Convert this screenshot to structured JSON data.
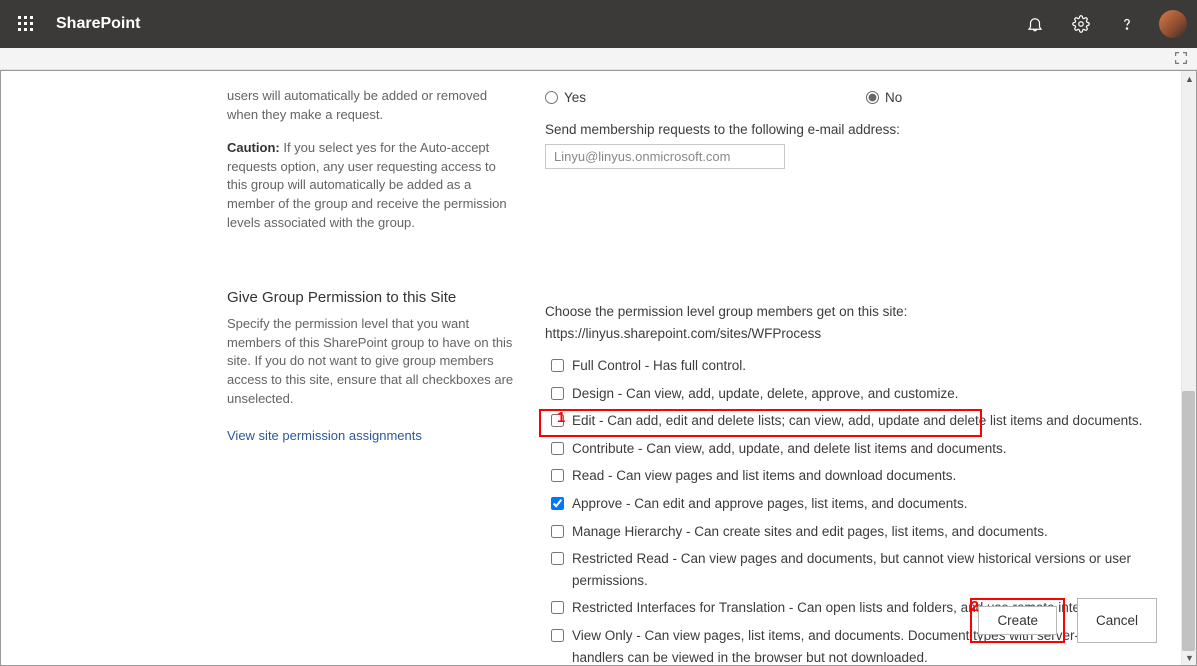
{
  "topbar": {
    "brand": "SharePoint"
  },
  "membership": {
    "truncated_text": "users will automatically be added or removed when they make a request.",
    "caution_label": "Caution:",
    "caution_text": " If you select yes for the Auto-accept requests option, any user requesting access to this group will automatically be added as a member of the group and receive the permission levels associated with the group.",
    "radio_yes": "Yes",
    "radio_no": "No",
    "email_label": "Send membership requests to the following e-mail address:",
    "email_value": "Linyu@linyus.onmicrosoft.com"
  },
  "permission": {
    "title": "Give Group Permission to this Site",
    "desc": "Specify the permission level that you want members of this SharePoint group to have on this site. If you do not want to give group members access to this site, ensure that all checkboxes are unselected.",
    "link": "View site permission assignments",
    "choose_label": "Choose the permission level group members get on this site: https://linyus.sharepoint.com/sites/WFProcess",
    "levels": [
      {
        "label": "Full Control - Has full control.",
        "checked": false
      },
      {
        "label": "Design - Can view, add, update, delete, approve, and customize.",
        "checked": false
      },
      {
        "label": "Edit - Can add, edit and delete lists; can view, add, update and delete list items and documents.",
        "checked": false
      },
      {
        "label": "Contribute - Can view, add, update, and delete list items and documents.",
        "checked": false
      },
      {
        "label": "Read - Can view pages and list items and download documents.",
        "checked": false
      },
      {
        "label": "Approve - Can edit and approve pages, list items, and documents.",
        "checked": true
      },
      {
        "label": "Manage Hierarchy - Can create sites and edit pages, list items, and documents.",
        "checked": false
      },
      {
        "label": "Restricted Read - Can view pages and documents, but cannot view historical versions or user permissions.",
        "checked": false
      },
      {
        "label": "Restricted Interfaces for Translation - Can open lists and folders, and use remote interfaces.",
        "checked": false
      },
      {
        "label": "View Only - Can view pages, list items, and documents. Document types with server-side file handlers can be viewed in the browser but not downloaded.",
        "checked": false
      }
    ]
  },
  "buttons": {
    "create": "Create",
    "cancel": "Cancel"
  },
  "annotations": {
    "a1": "1",
    "a2": "2"
  }
}
